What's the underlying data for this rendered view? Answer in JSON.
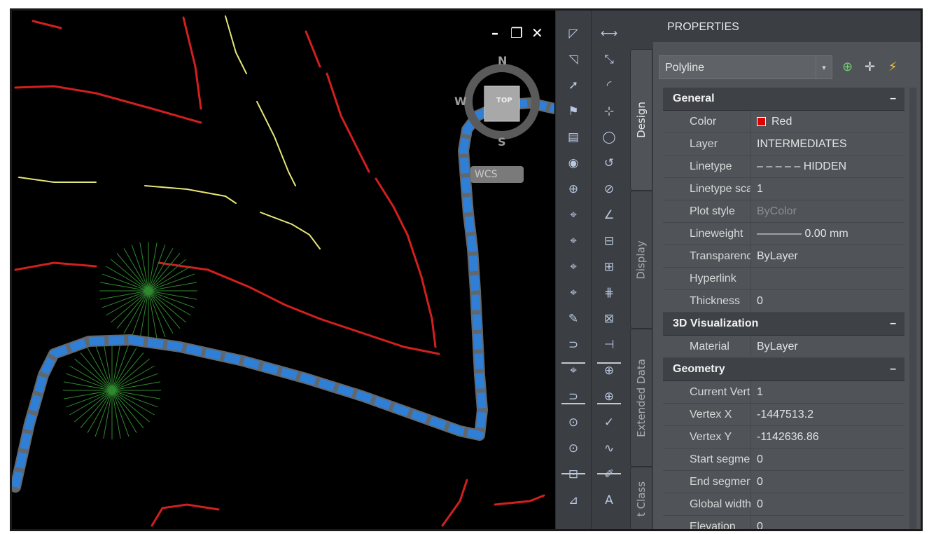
{
  "window": {
    "minimize_glyph": "–",
    "restore_glyph": "❐",
    "close_glyph": "✕"
  },
  "viewcube": {
    "north": "N",
    "south": "S",
    "west": "W",
    "top_face": "TOP",
    "wcs": "WCS"
  },
  "panel": {
    "title": "PROPERTIES",
    "selector_value": "Polyline",
    "selector_arrow": "▾",
    "icons": [
      "add-selection-icon",
      "select-objects-icon",
      "quick-select-icon"
    ],
    "tabs": [
      "Design",
      "Display",
      "Extended Data",
      "t Class"
    ]
  },
  "categories": {
    "general": {
      "label": "General",
      "collapse": "–",
      "rows": [
        {
          "name": "Color",
          "value": "Red"
        },
        {
          "name": "Layer",
          "value": "INTERMEDIATES"
        },
        {
          "name": "Linetype",
          "value": "– – – – – HIDDEN"
        },
        {
          "name": "Linetype sca...",
          "value": "1"
        },
        {
          "name": "Plot style",
          "value": "ByColor"
        },
        {
          "name": "Lineweight",
          "value": "———— 0.00 mm"
        },
        {
          "name": "Transparency",
          "value": "ByLayer"
        },
        {
          "name": "Hyperlink",
          "value": ""
        },
        {
          "name": "Thickness",
          "value": "0"
        }
      ]
    },
    "visualization": {
      "label": "3D Visualization",
      "collapse": "–",
      "rows": [
        {
          "name": "Material",
          "value": "ByLayer"
        }
      ]
    },
    "geometry": {
      "label": "Geometry",
      "collapse": "–",
      "rows": [
        {
          "name": "Current  Vert...",
          "value": "1"
        },
        {
          "name": "Vertex X",
          "value": "-1447513.2"
        },
        {
          "name": "Vertex Y",
          "value": "-1142636.86"
        },
        {
          "name": "Start  segme...",
          "value": "0"
        },
        {
          "name": "End  segmen...",
          "value": "0"
        },
        {
          "name": "Global width",
          "value": "0"
        },
        {
          "name": "Elevation",
          "value": "0"
        }
      ]
    }
  },
  "colors": {
    "selection_blue": "#2f7fd6",
    "contour_red": "#d21f1f",
    "contour_yellow": "#e6e67a",
    "tree_green": "#2f8a2f",
    "swatch_red": "#e00000"
  }
}
